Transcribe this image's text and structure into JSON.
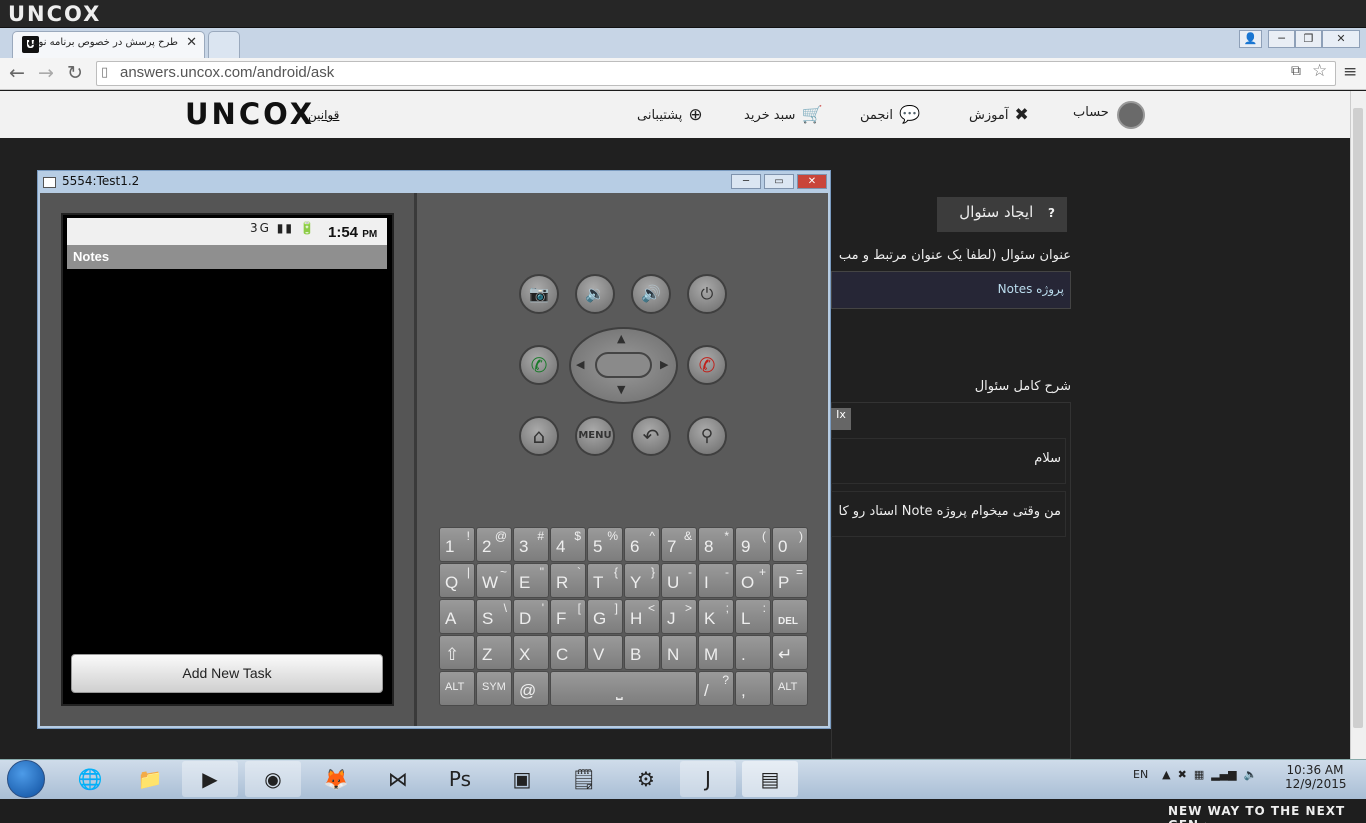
{
  "app": {
    "logo": "UNCOX"
  },
  "browser": {
    "tab_title": "طرح پرسش در خصوص برنامه نویسی",
    "tab_favicon": "U",
    "url": "answers.uncox.com/android/ask"
  },
  "site": {
    "logo": "UNCOX",
    "rules": "قوانین",
    "nav": [
      {
        "label": "حساب",
        "icon": "avatar"
      },
      {
        "label": "آموزش",
        "icon": "puzzle-icon"
      },
      {
        "label": "انجمن",
        "icon": "chat-icon"
      },
      {
        "label": "سبد خرید",
        "icon": "cart-icon"
      },
      {
        "label": "پشتیبانی",
        "icon": "support-icon"
      }
    ]
  },
  "form": {
    "heading": "ایجاد سئوال",
    "heading_icon": "?",
    "title_label": "عنوان سئوال (لطفاً یک عنوان مرتبط و مب",
    "title_value": "پروژه Notes",
    "desc_label": "شرح کامل سئوال",
    "editor_line1": "سلام",
    "editor_line2": "من وقتی میخوام پروژه Note استاد رو کا"
  },
  "emulator": {
    "window_title": "5554:Test1.2",
    "status_time": "1:54",
    "status_ampm": "PM",
    "status_icons": "3G",
    "app_title": "Notes",
    "button_label": "Add New Task",
    "keys_row1": [
      [
        "1",
        "!"
      ],
      [
        "2",
        "@"
      ],
      [
        "3",
        "#"
      ],
      [
        "4",
        "$"
      ],
      [
        "5",
        "%"
      ],
      [
        "6",
        "^"
      ],
      [
        "7",
        "&"
      ],
      [
        "8",
        "*"
      ],
      [
        "9",
        "("
      ],
      [
        "0",
        ")"
      ]
    ],
    "keys_row2": [
      [
        "Q",
        "|"
      ],
      [
        "W",
        "~"
      ],
      [
        "E",
        "\""
      ],
      [
        "R",
        "`"
      ],
      [
        "T",
        "{"
      ],
      [
        "Y",
        "}"
      ],
      [
        "U",
        "-"
      ],
      [
        "I",
        "-"
      ],
      [
        "O",
        "+"
      ],
      [
        "P",
        "="
      ]
    ],
    "keys_row3": [
      [
        "A",
        ""
      ],
      [
        "S",
        "\\"
      ],
      [
        "D",
        "'"
      ],
      [
        "F",
        "["
      ],
      [
        "G",
        "]"
      ],
      [
        "H",
        "<"
      ],
      [
        "J",
        ">"
      ],
      [
        "K",
        ";"
      ],
      [
        "L",
        ":"
      ],
      [
        "DEL",
        ""
      ]
    ],
    "keys_row4": [
      [
        "⇧",
        ""
      ],
      [
        "Z",
        ""
      ],
      [
        "X",
        ""
      ],
      [
        "C",
        ""
      ],
      [
        "V",
        ""
      ],
      [
        "B",
        ""
      ],
      [
        "N",
        ""
      ],
      [
        "M",
        ""
      ],
      [
        ".",
        ""
      ],
      [
        "↵",
        ""
      ]
    ],
    "key_alt": "ALT",
    "key_sym": "SYM",
    "key_at": "@",
    "key_slash": "/",
    "key_slash_alt": "?",
    "key_comma": ","
  },
  "taskbar": {
    "lang": "EN",
    "time": "10:36 AM",
    "date": "12/9/2015"
  },
  "footer": {
    "tagline": "NEW WAY TO THE NEXT GEN ›"
  }
}
